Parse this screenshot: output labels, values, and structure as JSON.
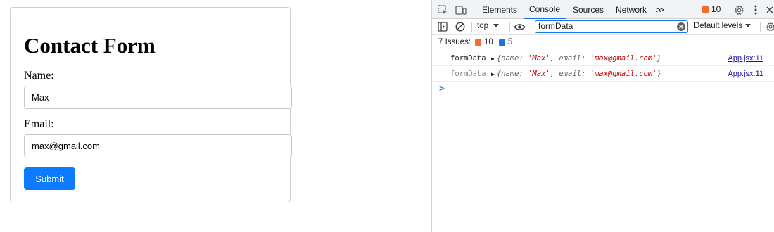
{
  "form": {
    "title": "Contact Form",
    "name_label": "Name:",
    "name_value": "Max",
    "email_label": "Email:",
    "email_value": "max@gmail.com",
    "submit_label": "Submit"
  },
  "devtools": {
    "tabs": [
      {
        "label": "Elements",
        "active": false
      },
      {
        "label": "Console",
        "active": true
      },
      {
        "label": "Sources",
        "active": false
      },
      {
        "label": "Network",
        "active": false
      }
    ],
    "more_tabs_label": ">>",
    "issues_badge_count": "10",
    "toolbar": {
      "context": "top",
      "filter_value": "formData",
      "levels_label": "Default levels"
    },
    "issues_bar": {
      "label": "7 Issues:",
      "warnings": "10",
      "info": "5"
    },
    "logs": [
      {
        "label": "formData",
        "name_key": "name:",
        "name_val": "'Max'",
        "email_key": "email:",
        "email_val": "'max@gmail.com'",
        "source": "App.jsx:11"
      },
      {
        "label": "formData",
        "name_key": "name:",
        "name_val": "'Max'",
        "email_key": "email:",
        "email_val": "'max@gmail.com'",
        "source": "App.jsx:11"
      }
    ],
    "prompt": ">"
  },
  "colors": {
    "accent": "#1a73e8",
    "submit": "#0b7cff",
    "string": "#c80000",
    "warning": "#f56b2a"
  }
}
